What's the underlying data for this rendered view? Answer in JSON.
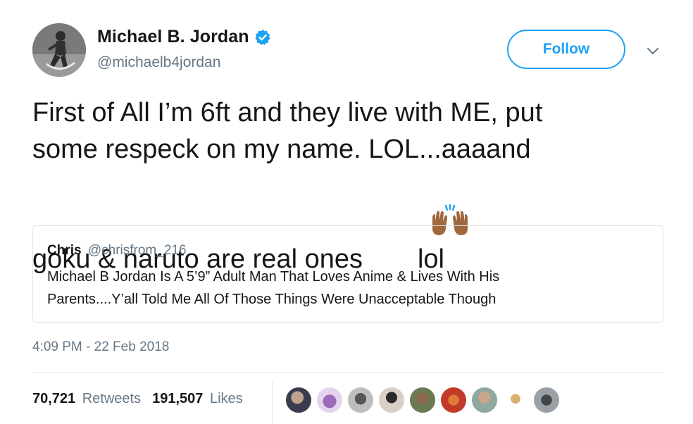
{
  "author": {
    "display_name": "Michael B. Jordan",
    "handle": "@michaelb4jordan",
    "verified": true
  },
  "actions": {
    "follow_label": "Follow",
    "menu_icon": "chevron-down-icon"
  },
  "tweet": {
    "line1": "First of All I’m 6ft and they live with ME, put",
    "line2": "some respeck on my name. LOL...aaaand",
    "line3_before": "goku & naruto are real ones",
    "emoji": "raising-hands-icon",
    "line3_after": "lol"
  },
  "quoted": {
    "name": "Chris",
    "handle": "@chrisfrom_216",
    "line1": "Michael B Jordan Is A 5’9” Adult Man That Loves Anime & Lives With His",
    "line2": "Parents....Y’all Told Me All Of Those Things Were Unacceptable Though"
  },
  "timestamp": "4:09 PM - 22 Feb 2018",
  "stats": {
    "retweets_count": "70,721",
    "retweets_label": "Retweets",
    "likes_count": "191,507",
    "likes_label": "Likes"
  },
  "colors": {
    "accent": "#1da1f2",
    "muted": "#657786",
    "text": "#14171a"
  },
  "likers": [
    "avatar-1",
    "avatar-2",
    "avatar-3",
    "avatar-4",
    "avatar-5",
    "avatar-6",
    "avatar-7",
    "avatar-8",
    "avatar-9",
    "avatar-10"
  ]
}
